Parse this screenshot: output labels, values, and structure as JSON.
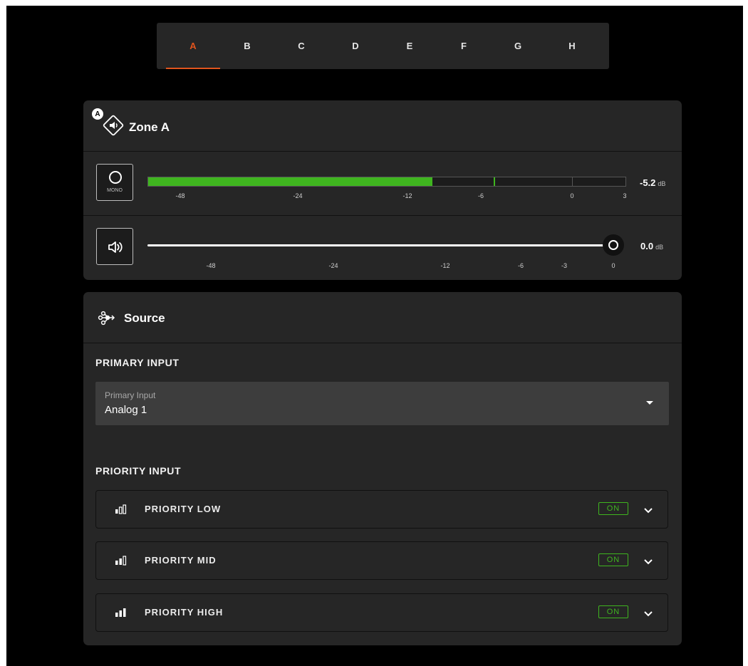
{
  "tabs": [
    {
      "label": "A",
      "active": true
    },
    {
      "label": "B",
      "active": false
    },
    {
      "label": "C",
      "active": false
    },
    {
      "label": "D",
      "active": false
    },
    {
      "label": "E",
      "active": false
    },
    {
      "label": "F",
      "active": false
    },
    {
      "label": "G",
      "active": false
    },
    {
      "label": "H",
      "active": false
    }
  ],
  "zone": {
    "badge": "A",
    "icon": "speaker-diamond-icon",
    "title": "Zone A",
    "mono_label": "MONO",
    "meter": {
      "level_db": -5.2,
      "value": "-5.2",
      "unit": "dB",
      "fill_color": "#3fb51f",
      "scale": [
        "-48",
        "-24",
        "-12",
        "-6",
        "0",
        "3"
      ]
    },
    "fader": {
      "level_db": 0.0,
      "value": "0.0",
      "unit": "dB",
      "scale": [
        "-48",
        "-24",
        "-12",
        "-6",
        "-3",
        "0"
      ]
    }
  },
  "source": {
    "icon": "source-nodes-icon",
    "title": "Source",
    "primary_section": "PRIMARY INPUT",
    "primary_field_label": "Primary Input",
    "primary_field_value": "Analog 1",
    "priority_section": "PRIORITY INPUT",
    "priorities": [
      {
        "label": "PRIORITY LOW",
        "status": "ON",
        "bars": 1
      },
      {
        "label": "PRIORITY MID",
        "status": "ON",
        "bars": 2
      },
      {
        "label": "PRIORITY HIGH",
        "status": "ON",
        "bars": 3
      }
    ]
  },
  "colors": {
    "accent": "#e0541d",
    "on": "#3fb51f",
    "panel": "#262626",
    "background": "#000000"
  }
}
